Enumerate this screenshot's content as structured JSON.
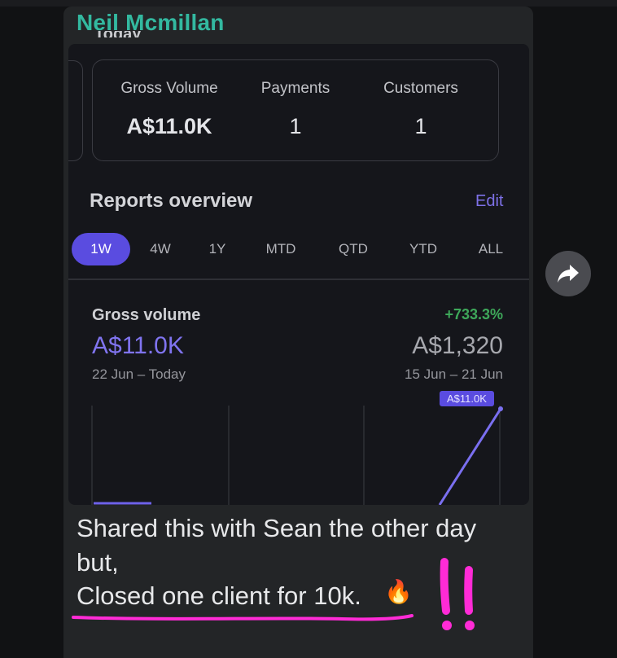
{
  "chat": {
    "sender_name": "Neil Mcmillan",
    "message_lines": [
      "Shared this with Sean the other day",
      "but,",
      "Closed one client for 10k."
    ],
    "emoji": "🔥",
    "annotation_marks": "!!",
    "forward_icon": "forward-arrow-icon"
  },
  "screenshot": {
    "section_title_partial": "Today",
    "stats": [
      {
        "label": "Gross Volume",
        "value": "A$11.0K"
      },
      {
        "label": "Payments",
        "value": "1"
      },
      {
        "label": "Customers",
        "value": "1"
      }
    ],
    "reports": {
      "title": "Reports overview",
      "edit_label": "Edit",
      "range_tabs": [
        "1W",
        "4W",
        "1Y",
        "MTD",
        "QTD",
        "YTD",
        "ALL"
      ],
      "active_tab": "1W"
    },
    "gross_volume": {
      "title": "Gross volume",
      "change_pct": "+733.3%",
      "current_value": "A$11.0K",
      "current_range": "22 Jun – Today",
      "previous_value": "A$1,320",
      "previous_range": "15 Jun – 21 Jun",
      "chart_tag": "A$11.0K"
    },
    "colors": {
      "accent": "#5a4ce0",
      "positive": "#3ea85a",
      "sender": "#33b9a0",
      "annotation": "#ff2bd6"
    }
  }
}
